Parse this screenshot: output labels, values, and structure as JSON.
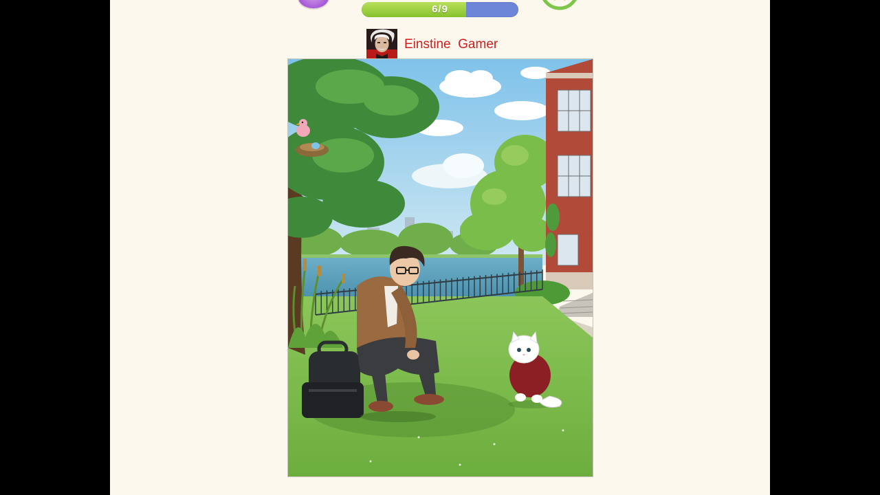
{
  "hud": {
    "progress_label": "6/9",
    "progress_value": 0.667,
    "left_icon": "purple-orb-icon",
    "right_icon": "star-ring-icon"
  },
  "player": {
    "name": "Einstine  Gamer",
    "avatar_icon": "einstein-avatar"
  },
  "scene": {
    "description_icons": [
      "tree",
      "bird-nest",
      "lake",
      "iron-fence",
      "brick-building",
      "young-man",
      "backpack",
      "white-cat-in-sweater"
    ]
  },
  "colors": {
    "page_bg": "#fdf8ee",
    "progress_fill": "#8fc935",
    "progress_track": "#6e86d8",
    "name_color": "#d11c1c"
  }
}
